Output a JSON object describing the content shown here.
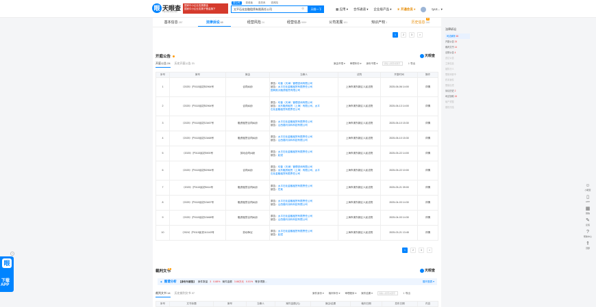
{
  "header": {
    "logo_text": "天眼查",
    "logo_sub": "TianYancha.com",
    "banner_line1": "国家中小企业发展基金",
    "banner_line2": "国家中小企业发展子基金旗下",
    "search_tabs": [
      "查公司",
      "查老板",
      "查关系",
      "查风险"
    ],
    "search_value": "太平石化金融租赁有限责任公司",
    "search_button": "天眼一下",
    "nav": [
      "应用",
      "合作通道",
      "企业级产品",
      "开通会员",
      "tyc4..."
    ]
  },
  "tabs": [
    {
      "label": "基本信息",
      "count": "287"
    },
    {
      "label": "法律诉讼",
      "count": "65"
    },
    {
      "label": "经营风险",
      "count": "24"
    },
    {
      "label": "经营信息",
      "count": "999+"
    },
    {
      "label": "公司发展",
      "count": "101"
    },
    {
      "label": "知识产权",
      "count": "1"
    },
    {
      "label": "历史信息",
      "count": "240",
      "badge": "新"
    }
  ],
  "pager_top": [
    "1",
    "2",
    "3",
    ">"
  ],
  "court_notice": {
    "title": "开庭公告",
    "logo": "天眼查",
    "subtabs": [
      {
        "label": "开庭公告",
        "count": "24"
      },
      {
        "label": "历史开庭公告",
        "count": "21"
      }
    ],
    "filters": [
      "案由不限",
      "审理年份",
      "身份不限"
    ],
    "search_placeholder": "请输入搜索关键字",
    "export": "导出",
    "columns": [
      "序号",
      "案号",
      "案由",
      "当事人",
      "法院",
      "开庭时间",
      "操作"
    ],
    "rows": [
      {
        "no": "1",
        "case": "（2025）沪0115民初52964号",
        "reason": "合同纠纷",
        "parties": [
          "原告：均普（天津）管理咨询有限公司",
          "被告：太平石化金融租赁有限责任公司",
          "国网英大融资租赁有限公司"
        ],
        "court": "上海市浦东新区人民法院",
        "time": "2025-06-06 14:00",
        "op": "详情"
      },
      {
        "no": "2",
        "case": "（2025）沪0115民初52964号",
        "reason": "合同纠纷",
        "parties": [
          "原告：均普（天津）管理咨询有限公司",
          "被告：远东融资租赁（上海）有限公司、太平",
          "石化金融租赁有限责任公司"
        ],
        "court": "上海市浦东新区人民法院",
        "time": "2025-06-13 14:00",
        "op": "详情"
      },
      {
        "no": "3",
        "case": "（2025）沪0115民初13467号",
        "reason": "融资租赁合同纠纷",
        "parties": [
          "原告：太平石化金融租赁有限责任公司",
          "被告：山西福马涂料科技有限公司"
        ],
        "court": "上海市浦东新区人民法院",
        "time": "2025-06-10 15:30",
        "op": "详情"
      },
      {
        "no": "4",
        "case": "（2025）沪0115民初13468号",
        "reason": "融资租赁合同纠纷",
        "parties": [
          "原告：太平石化金融租赁有限责任公司",
          "被告：山西福马涂料科技有限公司"
        ],
        "court": "上海市浦东新区人民法院",
        "time": "2025-06-10 15:30",
        "op": "详情"
      },
      {
        "no": "5",
        "case": "（2025）沪0115民初3900号",
        "reason": "劳动合同纠纷",
        "parties": [
          "原告：太平石化金融租赁有限责任公司",
          "被告：赵斌"
        ],
        "court": "上海市浦东新区人民法院",
        "time": "2025-05-22 14:00",
        "op": "详情"
      },
      {
        "no": "6",
        "case": "（2025）沪0115民初52964号",
        "reason": "合同纠纷",
        "parties": [
          "原告：均普（天津）管理咨询有限公司",
          "被告：远东融资租赁（上海）有限公司、太平",
          "石化金融租赁有限责任公司"
        ],
        "court": "上海市浦东新区人民法院",
        "time": "2025-05-22 10:00",
        "op": "详情"
      },
      {
        "no": "7",
        "case": "（2025）沪0115民初9414号",
        "reason": "融资租赁合同纠纷",
        "parties": [
          "原告：太平石化金融租赁有限责任公司",
          "被告：任某"
        ],
        "court": "上海市浦东新区人民法院",
        "time": "2025-05-21 09:00",
        "op": "详情"
      },
      {
        "no": "8",
        "case": "（2025）沪0115民初13467号",
        "reason": "融资租赁合同纠纷",
        "parties": [
          "原告：太平石化金融租赁有限责任公司",
          "被告：山西福马涂料科技有限公司"
        ],
        "court": "上海市浦东新区人民法院",
        "time": "2025-04-03 14:30",
        "op": "详情"
      },
      {
        "no": "9",
        "case": "（2025）沪0115民初13468号",
        "reason": "融资租赁合同纠纷",
        "parties": [
          "原告：太平石化金融租赁有限责任公司",
          "被告：山西福马涂料科技有限公司"
        ],
        "court": "上海市浦东新区人民法院",
        "time": "2025-04-03 14:30",
        "op": "详情"
      },
      {
        "no": "10",
        "case": "（2024）沪0115民初111143号",
        "reason": "劳动争议",
        "parties": [
          "原告：太平石化金融租赁有限责任公司",
          "被告：赵斌"
        ],
        "court": "上海市浦东新区人民法院",
        "time": "2025-03-21 13:45",
        "op": "详情"
      }
    ],
    "pager": [
      "1",
      "2",
      "3",
      ">"
    ]
  },
  "judgment": {
    "title": "裁判文书",
    "badge": "新",
    "logo": "天眼查",
    "analysis_title": "图谱分析",
    "analysis_tag": "【身份为被告】",
    "analysis_text1": "案件数量",
    "analysis_n1": "3",
    "analysis_p1": "0.88%",
    "analysis_text2": "案件金额",
    "analysis_n2": "3.88万元",
    "analysis_p2": "0.01%",
    "analysis_text3": "等多项数...",
    "analysis_more": "展开图表",
    "subtabs": [
      {
        "label": "裁判文书",
        "count": "14"
      },
      {
        "label": "历史裁判文书",
        "count": "37"
      }
    ],
    "filters": [
      "案件身份",
      "裁判年份",
      "审理程序",
      "案件结果"
    ],
    "search_placeholder": "请输入搜索关键字",
    "export": "导出",
    "columns": [
      "序号",
      "文书标题",
      "案号",
      "当事人",
      "案件金额(元)",
      "案由/结果",
      "裁判日期",
      "发布日期",
      "内容"
    ]
  },
  "sidebar": {
    "title": "法律诉讼",
    "items": [
      {
        "label": "司法解析",
        "count": "65",
        "active": true
      },
      {
        "label": "开庭公告",
        "count": "24"
      },
      {
        "label": "裁判文书",
        "count": "14"
      },
      {
        "label": "法院公告",
        "count": "4"
      },
      {
        "label": "送达公告",
        "count": "",
        "grey": true
      },
      {
        "label": "立案信息",
        "count": "",
        "grey": true
      },
      {
        "label": "被执行人",
        "count": "",
        "grey": true
      },
      {
        "label": "限制消费令",
        "count": "",
        "grey": true
      },
      {
        "label": "终本案件",
        "count": "",
        "grey": true
      },
      {
        "label": "限制出境",
        "count": "",
        "grey": true
      },
      {
        "label": "诉讼历史",
        "count": "2"
      },
      {
        "label": "司法协助",
        "count": "15"
      },
      {
        "label": "破产重整",
        "count": "",
        "grey": true
      },
      {
        "label": "股权冻结",
        "count": "",
        "grey": true
      }
    ]
  },
  "float_bar": [
    {
      "icon": "robot-icon",
      "label": "小眼查"
    },
    {
      "icon": "phone-icon",
      "label": "APP"
    },
    {
      "icon": "qrcode-icon",
      "label": "微信"
    },
    {
      "icon": "feedback-icon",
      "label": "反馈"
    },
    {
      "icon": "help-icon",
      "label": "帮助中心"
    },
    {
      "icon": "top-icon",
      "label": "顶部"
    }
  ],
  "download": {
    "line1": "下载",
    "line2": "APP"
  }
}
